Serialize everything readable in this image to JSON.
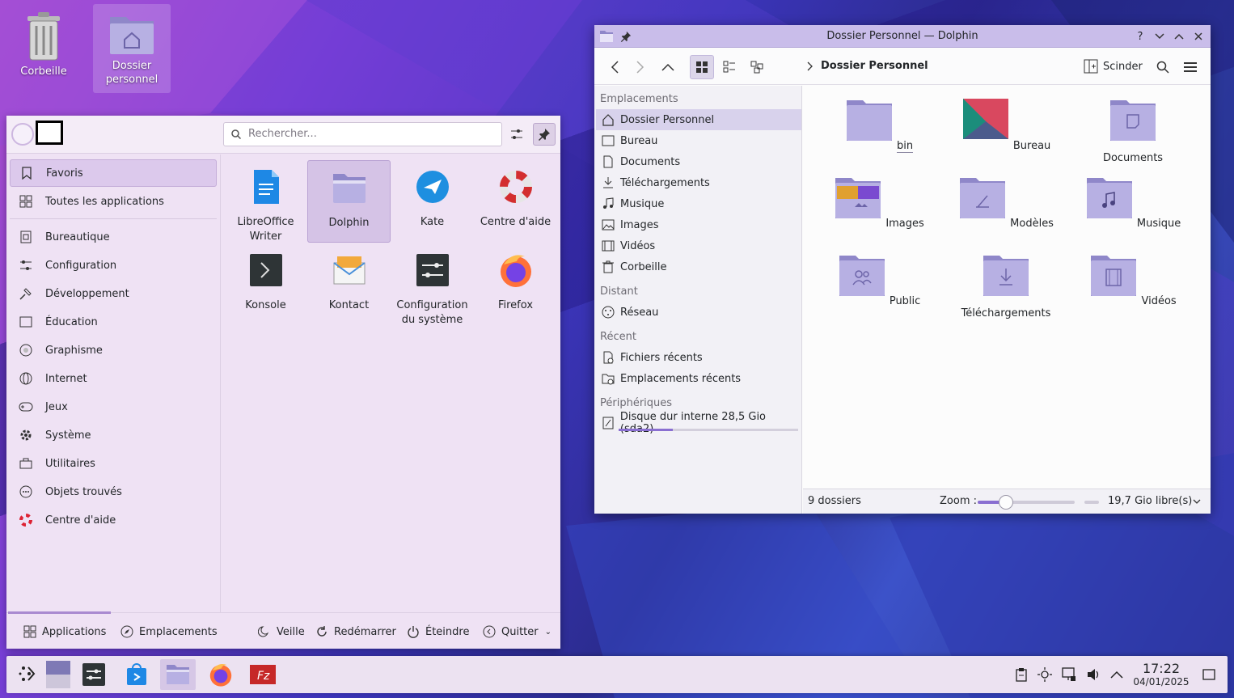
{
  "desktop": {
    "icons": [
      {
        "label_line1": "Corbeille",
        "label_line2": ""
      },
      {
        "label_line1": "Dossier",
        "label_line2": "personnel"
      }
    ]
  },
  "launcher": {
    "search_placeholder": "Rechercher...",
    "categories": [
      {
        "label": "Favoris",
        "icon": "bookmark-icon"
      },
      {
        "label": "Toutes les applications",
        "icon": "grid-icon"
      },
      {
        "label": "Bureautique",
        "icon": "office-icon"
      },
      {
        "label": "Configuration",
        "icon": "settings-sliders-icon"
      },
      {
        "label": "Développement",
        "icon": "hammer-icon"
      },
      {
        "label": "Éducation",
        "icon": "education-icon"
      },
      {
        "label": "Graphisme",
        "icon": "graphics-icon"
      },
      {
        "label": "Internet",
        "icon": "globe-icon"
      },
      {
        "label": "Jeux",
        "icon": "gamepad-icon"
      },
      {
        "label": "Système",
        "icon": "gear-icon"
      },
      {
        "label": "Utilitaires",
        "icon": "toolbox-icon"
      },
      {
        "label": "Objets trouvés",
        "icon": "dots-icon"
      },
      {
        "label": "Centre d'aide",
        "icon": "lifebuoy-icon"
      }
    ],
    "apps": [
      {
        "line1": "LibreOffice",
        "line2": "Writer"
      },
      {
        "line1": "Dolphin",
        "line2": ""
      },
      {
        "line1": "Kate",
        "line2": ""
      },
      {
        "line1": "Centre d'aide",
        "line2": ""
      },
      {
        "line1": "Konsole",
        "line2": ""
      },
      {
        "line1": "Kontact",
        "line2": ""
      },
      {
        "line1": "Configuration",
        "line2": "du système"
      },
      {
        "line1": "Firefox",
        "line2": ""
      }
    ],
    "bottom": {
      "applications": "Applications",
      "places": "Emplacements",
      "sleep": "Veille",
      "restart": "Redémarrer",
      "shutdown": "Éteindre",
      "quit": "Quitter"
    }
  },
  "dolphin": {
    "title": "Dossier Personnel — Dolphin",
    "breadcrumb": "Dossier Personnel",
    "split_label": "Scinder",
    "places": {
      "h_places": "Emplacements",
      "h_remote": "Distant",
      "h_recent": "Récent",
      "h_devices": "Périphériques",
      "items": [
        "Dossier Personnel",
        "Bureau",
        "Documents",
        "Téléchargements",
        "Musique",
        "Images",
        "Vidéos",
        "Corbeille"
      ],
      "remote": [
        "Réseau"
      ],
      "recent": [
        "Fichiers récents",
        "Emplacements récents"
      ],
      "devices": [
        "Disque dur interne 28,5 Gio (sda2)"
      ],
      "disk_used_fraction": 0.3
    },
    "folders": [
      {
        "name": "bin",
        "icon": "folder-icon"
      },
      {
        "name": "Bureau",
        "icon": "desktop-folder-icon"
      },
      {
        "name": "Documents",
        "icon": "documents-folder-icon"
      },
      {
        "name": "Images",
        "icon": "pictures-folder-icon"
      },
      {
        "name": "Modèles",
        "icon": "templates-folder-icon"
      },
      {
        "name": "Musique",
        "icon": "music-folder-icon"
      },
      {
        "name": "Public",
        "icon": "public-folder-icon"
      },
      {
        "name": "Téléchargements",
        "icon": "downloads-folder-icon"
      },
      {
        "name": "Vidéos",
        "icon": "videos-folder-icon"
      }
    ],
    "status": {
      "count": "9 dossiers",
      "zoom_label": "Zoom :",
      "free": "19,7 Gio libre(s)"
    }
  },
  "taskbar": {
    "time": "17:22",
    "date": "04/01/2025"
  },
  "colors": {
    "accent": "#8a6fd1",
    "folder": "#b7b0e3",
    "launcher_bg": "#efe2f4"
  }
}
